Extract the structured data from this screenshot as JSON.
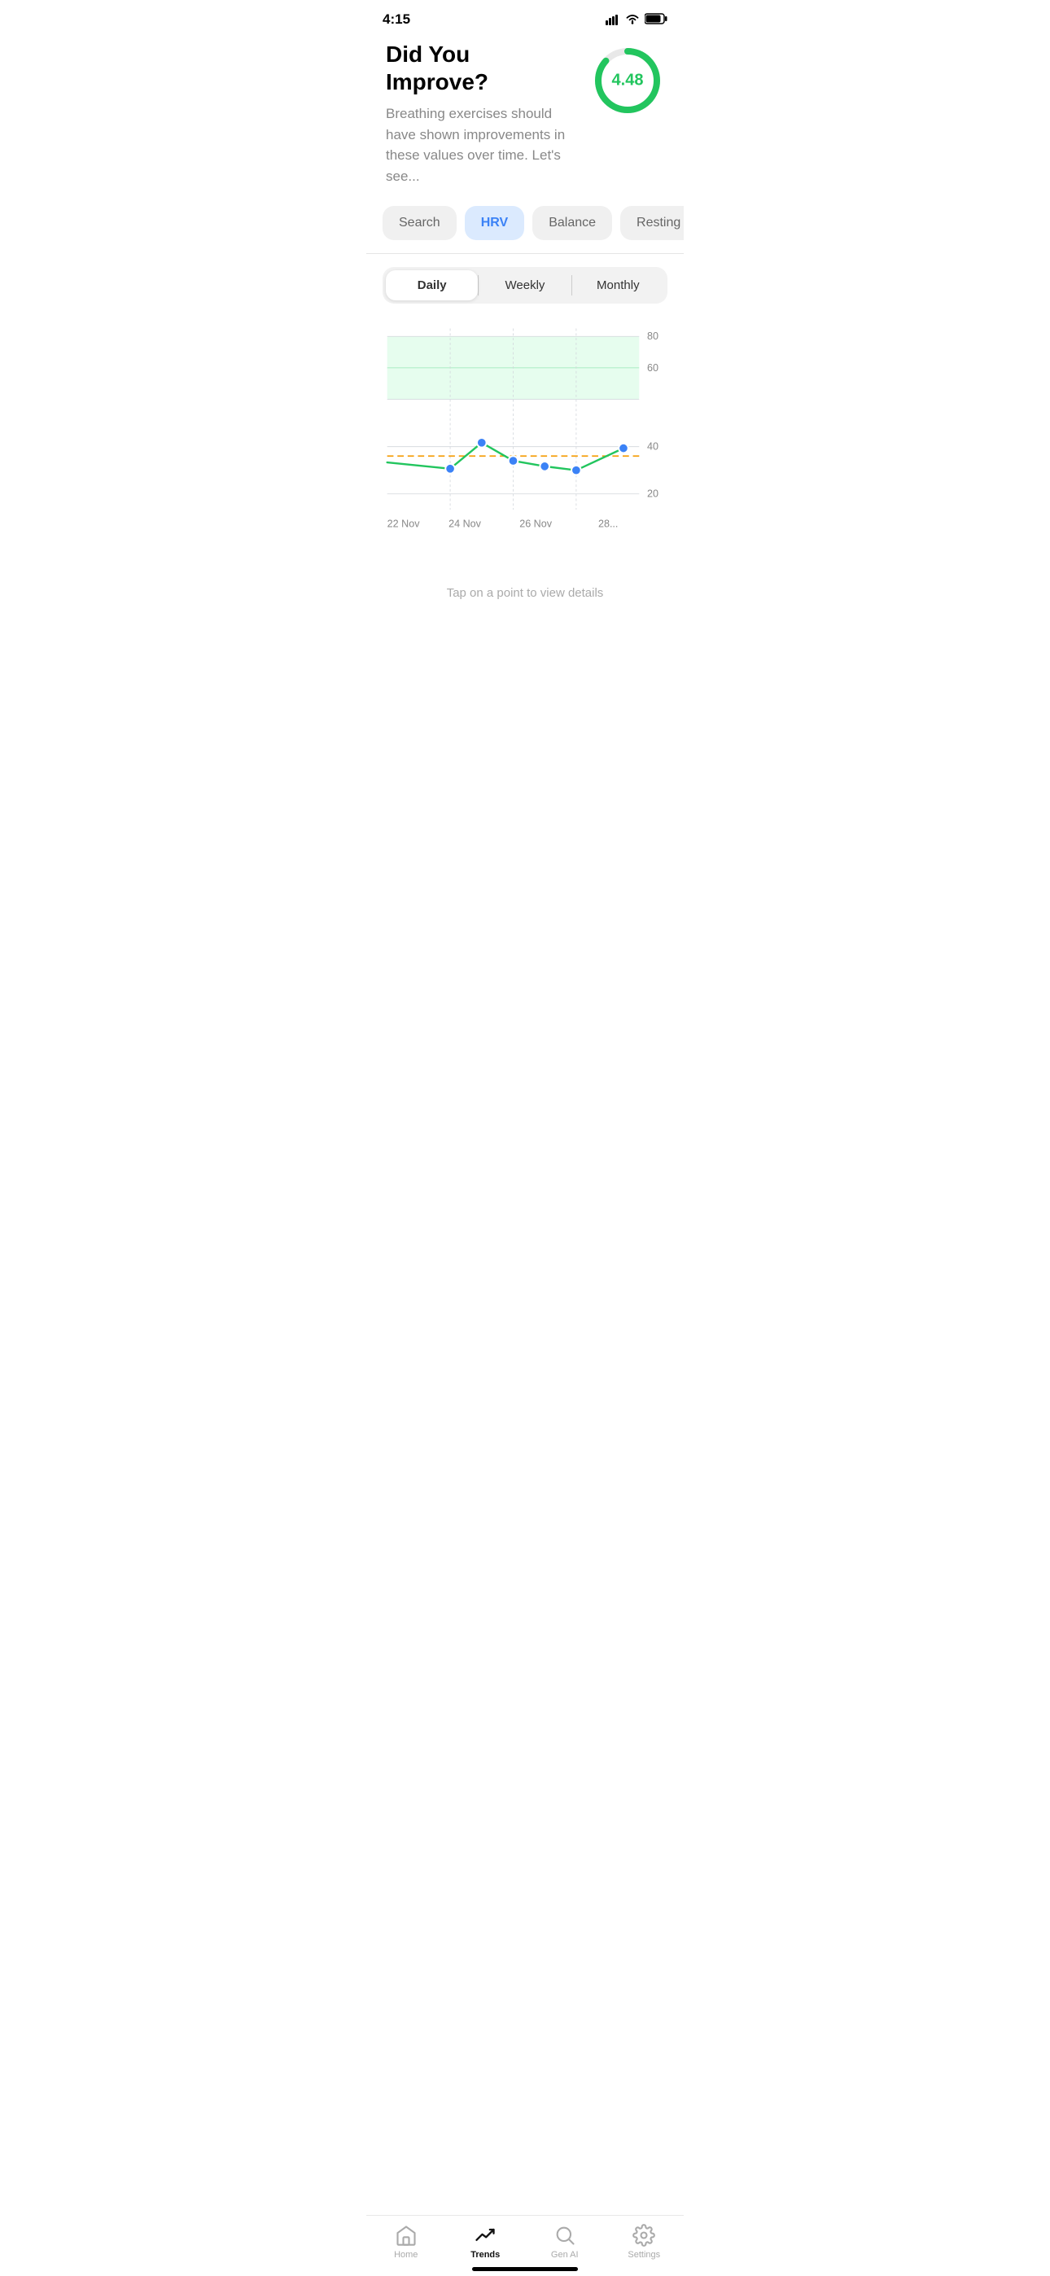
{
  "statusBar": {
    "time": "4:15",
    "battery": "84"
  },
  "header": {
    "title": "Did You Improve?",
    "description": "Breathing exercises should have shown improvements in these values over time. Let's see...",
    "score": "4.48"
  },
  "filterTabs": [
    {
      "id": "search",
      "label": "Search",
      "active": false
    },
    {
      "id": "hrv",
      "label": "HRV",
      "active": true
    },
    {
      "id": "balance",
      "label": "Balance",
      "active": false
    },
    {
      "id": "resting",
      "label": "Resting",
      "active": false
    }
  ],
  "periodSelector": {
    "options": [
      {
        "id": "daily",
        "label": "Daily",
        "active": true
      },
      {
        "id": "weekly",
        "label": "Weekly",
        "active": false
      },
      {
        "id": "monthly",
        "label": "Monthly",
        "active": false
      }
    ]
  },
  "chart": {
    "yLabels": [
      "80",
      "60",
      "40",
      "20"
    ],
    "xLabels": [
      "22 Nov",
      "24 Nov",
      "26 Nov",
      "28..."
    ],
    "tapHint": "Tap on a point to view details"
  },
  "bottomNav": [
    {
      "id": "home",
      "label": "Home",
      "active": false,
      "icon": "home"
    },
    {
      "id": "trends",
      "label": "Trends",
      "active": true,
      "icon": "trends"
    },
    {
      "id": "genai",
      "label": "Gen AI",
      "active": false,
      "icon": "search"
    },
    {
      "id": "settings",
      "label": "Settings",
      "active": false,
      "icon": "gear"
    }
  ]
}
